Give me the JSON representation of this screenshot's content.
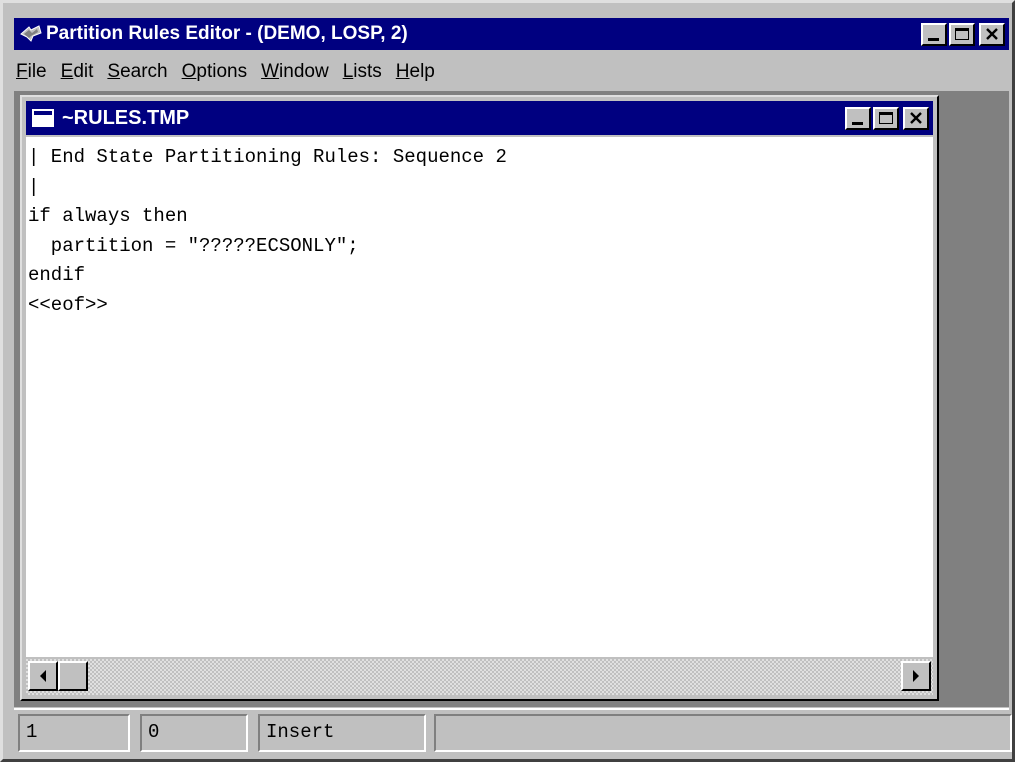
{
  "window": {
    "title": "Partition Rules Editor - (DEMO, LOSP, 2)",
    "icon": "app-icon",
    "titlebar_color": "#000080"
  },
  "menu": [
    {
      "label": "File",
      "mnemonic": "F"
    },
    {
      "label": "Edit",
      "mnemonic": "E"
    },
    {
      "label": "Search",
      "mnemonic": "S"
    },
    {
      "label": "Options",
      "mnemonic": "O"
    },
    {
      "label": "Window",
      "mnemonic": "W"
    },
    {
      "label": "Lists",
      "mnemonic": "L"
    },
    {
      "label": "Help",
      "mnemonic": "H"
    }
  ],
  "child_window": {
    "title": "~RULES.TMP",
    "icon": "document-icon"
  },
  "editor": {
    "lines": [
      "| End State Partitioning Rules: Sequence 2",
      "|",
      "if always then",
      "  partition = \"?????ECSONLY\";",
      "endif",
      "<<eof>>"
    ]
  },
  "status": {
    "line": "1",
    "column": "0",
    "mode": "Insert",
    "message": ""
  }
}
